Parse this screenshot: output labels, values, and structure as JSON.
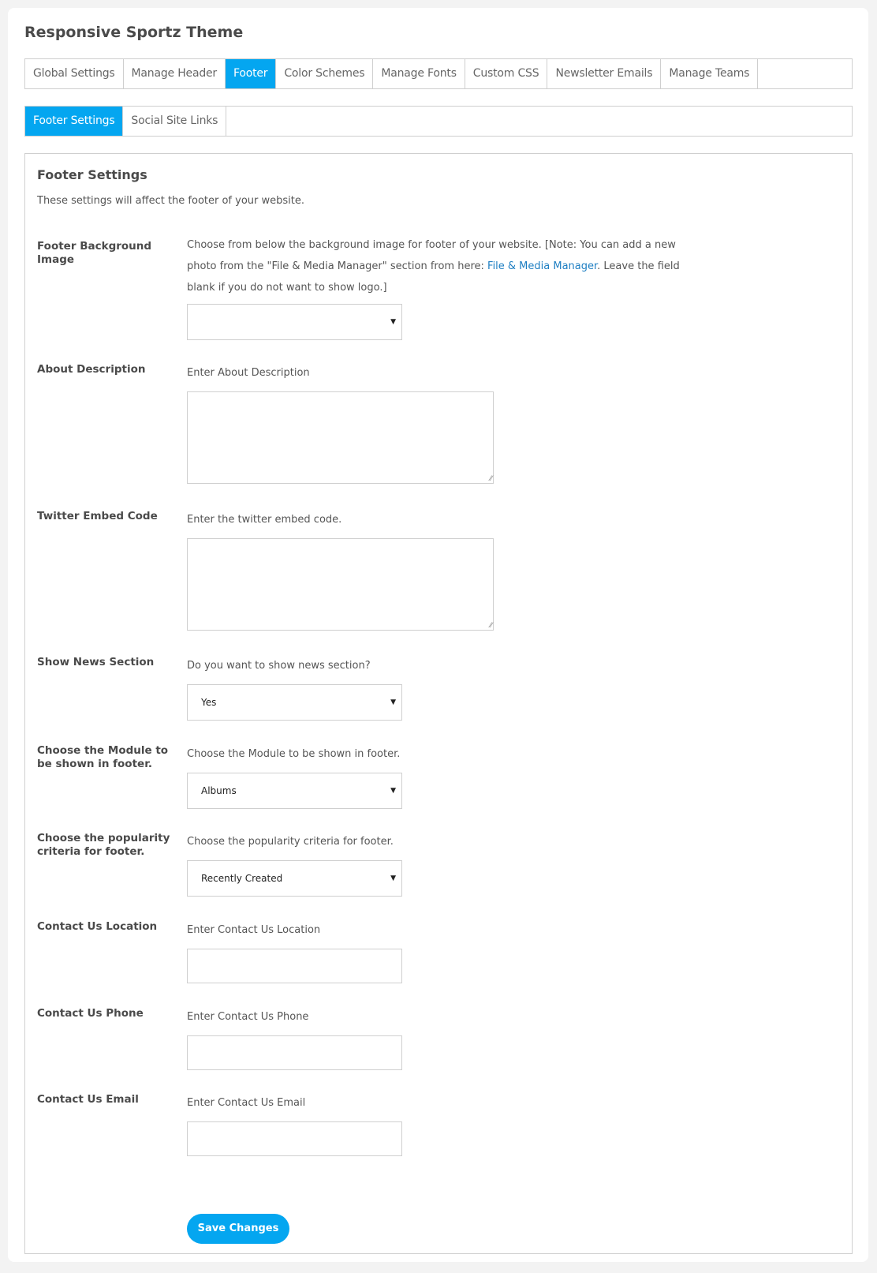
{
  "header": {
    "title": "Responsive Sportz Theme"
  },
  "main_tabs": [
    {
      "label": "Global Settings",
      "active": false
    },
    {
      "label": "Manage Header",
      "active": false
    },
    {
      "label": "Footer",
      "active": true
    },
    {
      "label": "Color Schemes",
      "active": false
    },
    {
      "label": "Manage Fonts",
      "active": false
    },
    {
      "label": "Custom CSS",
      "active": false
    },
    {
      "label": "Newsletter Emails",
      "active": false
    },
    {
      "label": "Manage Teams",
      "active": false
    }
  ],
  "sub_tabs": [
    {
      "label": "Footer Settings",
      "active": true
    },
    {
      "label": "Social Site Links",
      "active": false
    }
  ],
  "panel": {
    "title": "Footer Settings",
    "description": "These settings will affect the footer of your website."
  },
  "fields": {
    "background_image": {
      "label": "Footer Background Image",
      "desc_before": "Choose from below the background image for footer of your website. [Note: You can add a new photo from the \"File & Media Manager\" section from here: ",
      "link_text": "File & Media Manager",
      "desc_after": ". Leave the field blank if you do not want to show logo.]",
      "value": ""
    },
    "about": {
      "label": "About Description",
      "desc": "Enter About Description",
      "value": ""
    },
    "twitter": {
      "label": "Twitter Embed Code",
      "desc": "Enter the twitter embed code.",
      "value": ""
    },
    "news": {
      "label": "Show News Section",
      "desc": "Do you want to show news section?",
      "value": "Yes"
    },
    "module": {
      "label": "Choose the Module to be shown in footer.",
      "desc": "Choose the Module to be shown in footer.",
      "value": "Albums"
    },
    "popularity": {
      "label": "Choose the popularity criteria for footer.",
      "desc": "Choose the popularity criteria for footer.",
      "value": "Recently Created"
    },
    "location": {
      "label": "Contact Us Location",
      "desc": "Enter Contact Us Location",
      "value": ""
    },
    "phone": {
      "label": "Contact Us Phone",
      "desc": "Enter Contact Us Phone",
      "value": ""
    },
    "email": {
      "label": "Contact Us Email",
      "desc": "Enter Contact Us Email",
      "value": ""
    }
  },
  "icons": {
    "dropdown_arrow": "▼",
    "resize_grip": "⁄⁄"
  },
  "actions": {
    "save_label": "Save Changes"
  },
  "colors": {
    "accent": "#04a6f0",
    "link": "#1d7ec2",
    "border": "#cfcfcf"
  }
}
